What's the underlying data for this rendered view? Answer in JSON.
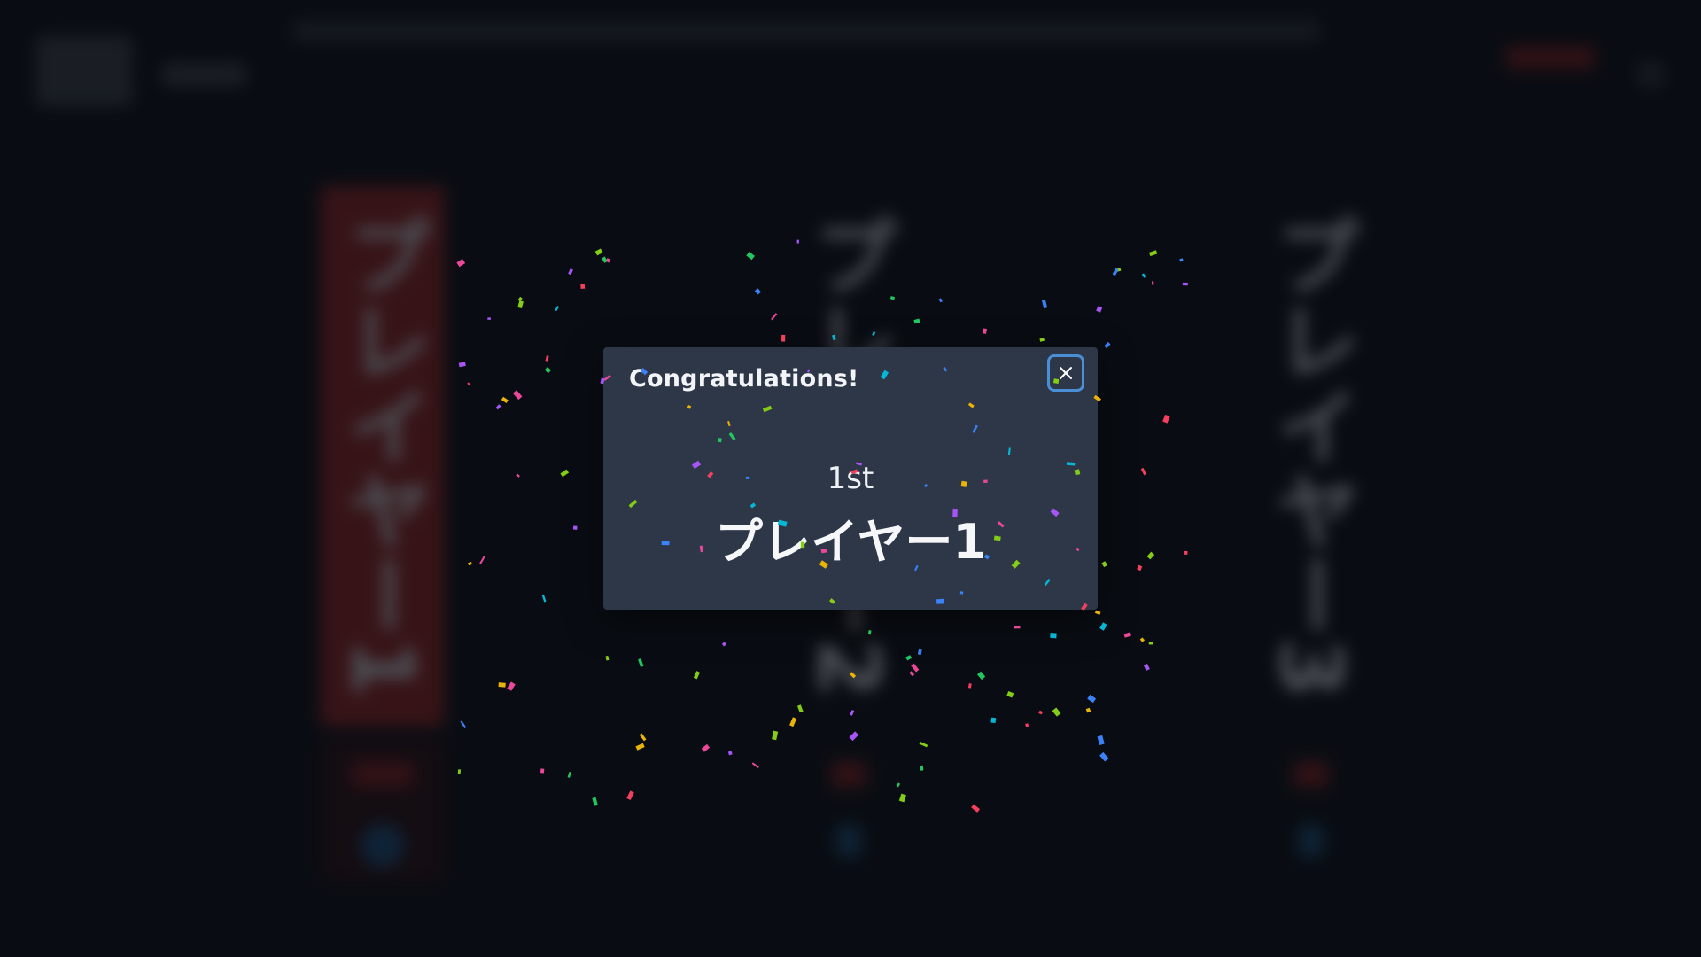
{
  "background": {
    "columns": [
      {
        "label": "プレイヤー1",
        "color": "#8c2323"
      },
      {
        "label": "プレイヤー2",
        "color": "#0c1016"
      },
      {
        "label": "プレイヤー3",
        "color": "#0c1016"
      }
    ]
  },
  "modal": {
    "title": "Congratulations!",
    "close_icon": "close-icon",
    "rank": "1st",
    "winner": "プレイヤー1"
  },
  "colors": {
    "accent": "#4a8fd6",
    "modal_bg": "#2e3748",
    "confetti": [
      "#a855f7",
      "#22c55e",
      "#06b6d4",
      "#eab308",
      "#f43f5e",
      "#84cc16",
      "#3b82f6",
      "#ec4899"
    ]
  }
}
